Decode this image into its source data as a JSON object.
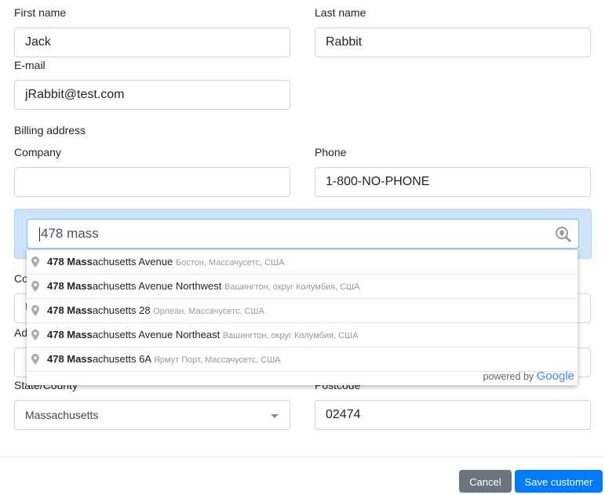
{
  "form": {
    "first_name": {
      "label": "First name",
      "value": "Jack"
    },
    "last_name": {
      "label": "Last name",
      "value": "Rabbit"
    },
    "email": {
      "label": "E-mail",
      "value": "jRabbit@test.com"
    },
    "billing_heading": "Billing address",
    "company": {
      "label": "Company",
      "value": ""
    },
    "phone": {
      "label": "Phone",
      "value": "1-800-NO-PHONE"
    },
    "country": {
      "label": "Co",
      "value": "U"
    },
    "address": {
      "label": "Ad"
    },
    "state": {
      "label": "State/County",
      "value": "Massachusetts"
    },
    "postcode": {
      "label": "Postcode",
      "value": "02474"
    }
  },
  "autocomplete": {
    "query": "478 mass",
    "suggestions": [
      {
        "match": "478 Mass",
        "rest": "achusetts Avenue",
        "secondary": "Бостон, Массачусетс, США"
      },
      {
        "match": "478 Mass",
        "rest": "achusetts Avenue Northwest",
        "secondary": "Вашингтон, округ Колумбия, США"
      },
      {
        "match": "478 Mass",
        "rest": "achusetts 28",
        "secondary": "Орлеан, Массачусетс, США"
      },
      {
        "match": "478 Mass",
        "rest": "achusetts Avenue Northeast",
        "secondary": "Вашингтон, округ Колумбия, США"
      },
      {
        "match": "478 Mass",
        "rest": "achusetts 6A",
        "secondary": "Ярмут Порт, Массачусетс, США"
      }
    ],
    "powered_by": "powered by",
    "brand": "Google"
  },
  "footer": {
    "cancel": "Cancel",
    "save": "Save customer"
  },
  "colors": {
    "primary": "#007bff",
    "secondary": "#6c757d",
    "band": "#cce5fb"
  }
}
